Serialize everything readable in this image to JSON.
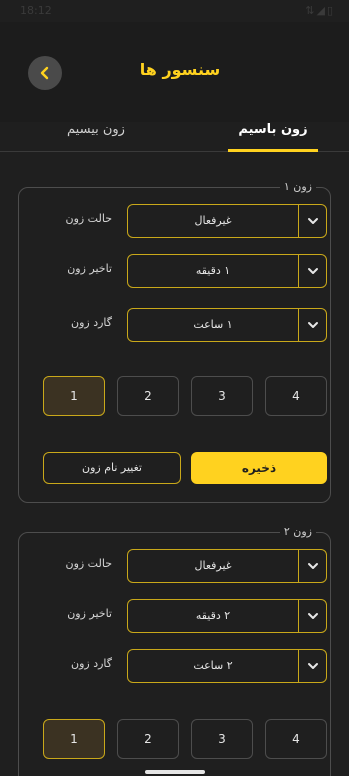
{
  "status_bar": {
    "time": "18:12",
    "icons": "⇅◢▯"
  },
  "header": {
    "title": "سنسور ها"
  },
  "tabs": [
    {
      "label": "زون باسیم",
      "active": true
    },
    {
      "label": "زون بیسیم",
      "active": false
    }
  ],
  "zones": [
    {
      "legend": "زون ۱",
      "mode_label": "حالت زون",
      "mode_value": "غیرفعال",
      "delay_label": "تاخیر زون",
      "delay_value": "۱ دقیقه",
      "guard_label": "گارد زون",
      "guard_value": "۱ ساعت",
      "numbers": [
        "1",
        "2",
        "3",
        "4"
      ],
      "selected_number": "1",
      "save_label": "ذخیره",
      "rename_label": "تغییر نام زون"
    },
    {
      "legend": "زون ۲",
      "mode_label": "حالت زون",
      "mode_value": "غیرفعال",
      "delay_label": "تاخیر زون",
      "delay_value": "۲ دقیقه",
      "guard_label": "گارد زون",
      "guard_value": "۲ ساعت",
      "numbers": [
        "1",
        "2",
        "3",
        "4"
      ],
      "selected_number": "1"
    }
  ],
  "colors": {
    "accent": "#ffd21f",
    "background": "#1f1f1f",
    "border": "#4d4d4d"
  },
  "icons": {
    "back": "chevron-left-icon",
    "caret": "chevron-down-icon"
  }
}
